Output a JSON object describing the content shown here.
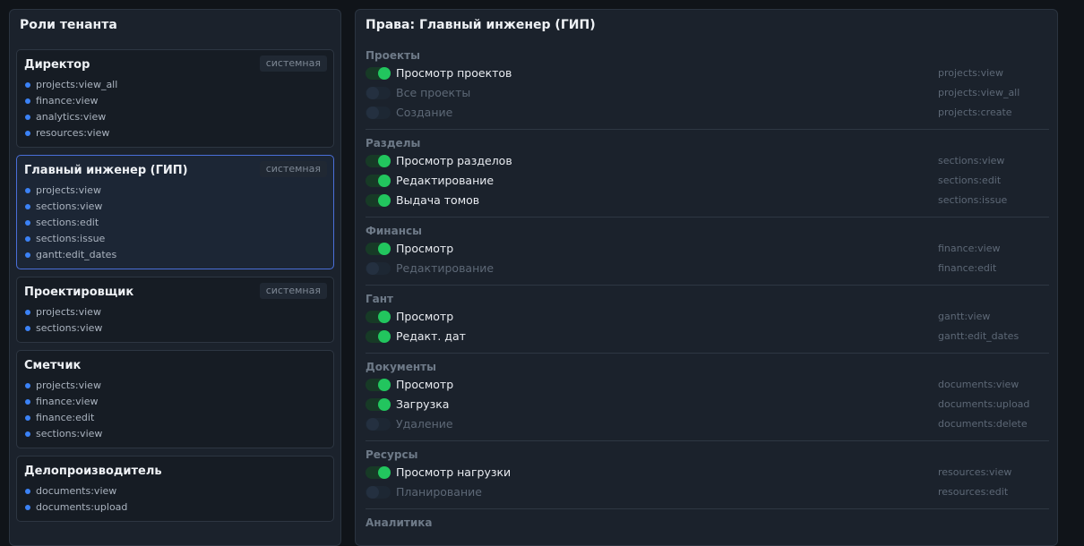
{
  "roles_panel": {
    "title": "Роли тенанта",
    "roles": [
      {
        "name": "Директор",
        "badge": "системная",
        "perms": [
          "projects:view_all",
          "finance:view",
          "analytics:view",
          "resources:view"
        ]
      },
      {
        "name": "Главный инженер (ГИП)",
        "badge": "системная",
        "active": true,
        "perms": [
          "projects:view",
          "sections:view",
          "sections:edit",
          "sections:issue",
          "gantt:edit_dates"
        ]
      },
      {
        "name": "Проектировщик",
        "badge": "системная",
        "perms": [
          "projects:view",
          "sections:view"
        ]
      },
      {
        "name": "Сметчик",
        "badge": "",
        "perms": [
          "projects:view",
          "finance:view",
          "finance:edit",
          "sections:view"
        ]
      },
      {
        "name": "Делопроизводитель",
        "badge": "",
        "perms": [
          "documents:view",
          "documents:upload"
        ]
      }
    ]
  },
  "permissions_panel": {
    "title": "Права: Главный инженер (ГИП)",
    "groups": [
      {
        "title": "Проекты",
        "items": [
          {
            "label": "Просмотр проектов",
            "key": "projects:view",
            "enabled": true
          },
          {
            "label": "Все проекты",
            "key": "projects:view_all",
            "enabled": false
          },
          {
            "label": "Создание",
            "key": "projects:create",
            "enabled": false
          }
        ]
      },
      {
        "title": "Разделы",
        "items": [
          {
            "label": "Просмотр разделов",
            "key": "sections:view",
            "enabled": true
          },
          {
            "label": "Редактирование",
            "key": "sections:edit",
            "enabled": true
          },
          {
            "label": "Выдача томов",
            "key": "sections:issue",
            "enabled": true
          }
        ]
      },
      {
        "title": "Финансы",
        "items": [
          {
            "label": "Просмотр",
            "key": "finance:view",
            "enabled": true
          },
          {
            "label": "Редактирование",
            "key": "finance:edit",
            "enabled": false
          }
        ]
      },
      {
        "title": "Гант",
        "items": [
          {
            "label": "Просмотр",
            "key": "gantt:view",
            "enabled": true
          },
          {
            "label": "Редакт. дат",
            "key": "gantt:edit_dates",
            "enabled": true
          }
        ]
      },
      {
        "title": "Документы",
        "items": [
          {
            "label": "Просмотр",
            "key": "documents:view",
            "enabled": true
          },
          {
            "label": "Загрузка",
            "key": "documents:upload",
            "enabled": true
          },
          {
            "label": "Удаление",
            "key": "documents:delete",
            "enabled": false
          }
        ]
      },
      {
        "title": "Ресурсы",
        "items": [
          {
            "label": "Просмотр нагрузки",
            "key": "resources:view",
            "enabled": true
          },
          {
            "label": "Планирование",
            "key": "resources:edit",
            "enabled": false
          }
        ]
      },
      {
        "title": "Аналитика",
        "items": []
      }
    ]
  }
}
